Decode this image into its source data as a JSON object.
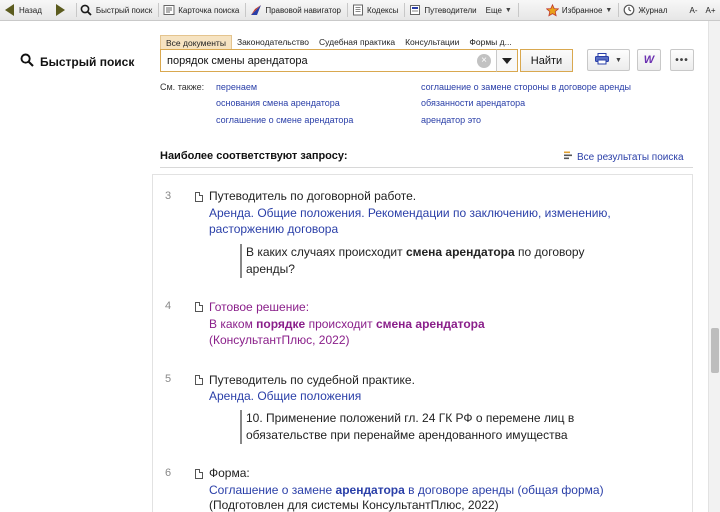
{
  "toolbar": {
    "back": "Назад",
    "quick_search": "Быстрый поиск",
    "card_search": "Карточка поиска",
    "legal_navigator": "Правовой навигатор",
    "codes": "Кодексы",
    "guides": "Путеводители",
    "more": "Еще",
    "favorites": "Избранное",
    "journal": "Журнал",
    "font_size": "A-",
    "font_size_plus": "A+"
  },
  "left_label": "Быстрый поиск",
  "tabs": [
    "Все документы",
    "Законодательство",
    "Судебная практика",
    "Консультации",
    "Формы д..."
  ],
  "search": {
    "value": "порядок смены арендатора",
    "find_button": "Найти"
  },
  "see_also": {
    "label": "См. также:",
    "links": [
      "перенаем",
      "основания смена арендатора",
      "соглашение о смене арендатора",
      "соглашение о замене стороны в договоре аренды",
      "обязанности арендатора",
      "арендатор это"
    ]
  },
  "best_match_heading": "Наиболее соответствуют запросу:",
  "all_results": "Все результаты поиска",
  "results": [
    {
      "num": "3",
      "type": "Путеводитель по договорной работе.",
      "title_line1": "Аренда. Общие положения. Рекомендации по заключению, изменению,",
      "title_line2": "расторжению договора",
      "quote_pre": "В каких случаях происходит ",
      "quote_bold": "смена арендатора",
      "quote_post": " по договору",
      "quote_line2": "аренды?"
    },
    {
      "num": "4",
      "type": "Готовое решение:",
      "title_pre": "В каком ",
      "title_bold1": "порядке",
      "title_mid": " происходит ",
      "title_bold2": "смена арендатора",
      "sub": "(КонсультантПлюс, 2022)"
    },
    {
      "num": "5",
      "type": "Путеводитель по судебной практике.",
      "title": "Аренда. Общие положения",
      "quote_line1": "10. Применение положений гл. 24 ГК РФ о перемене лиц в",
      "quote_line2": "обязательстве при перенайме арендованного имущества"
    },
    {
      "num": "6",
      "type": "Форма:",
      "title_pre": "Соглашение о замене ",
      "title_bold": "арендатора",
      "title_post": " в договоре аренды (общая форма)",
      "sub": "(Подготовлен для системы КонсультантПлюс, 2022)"
    }
  ]
}
